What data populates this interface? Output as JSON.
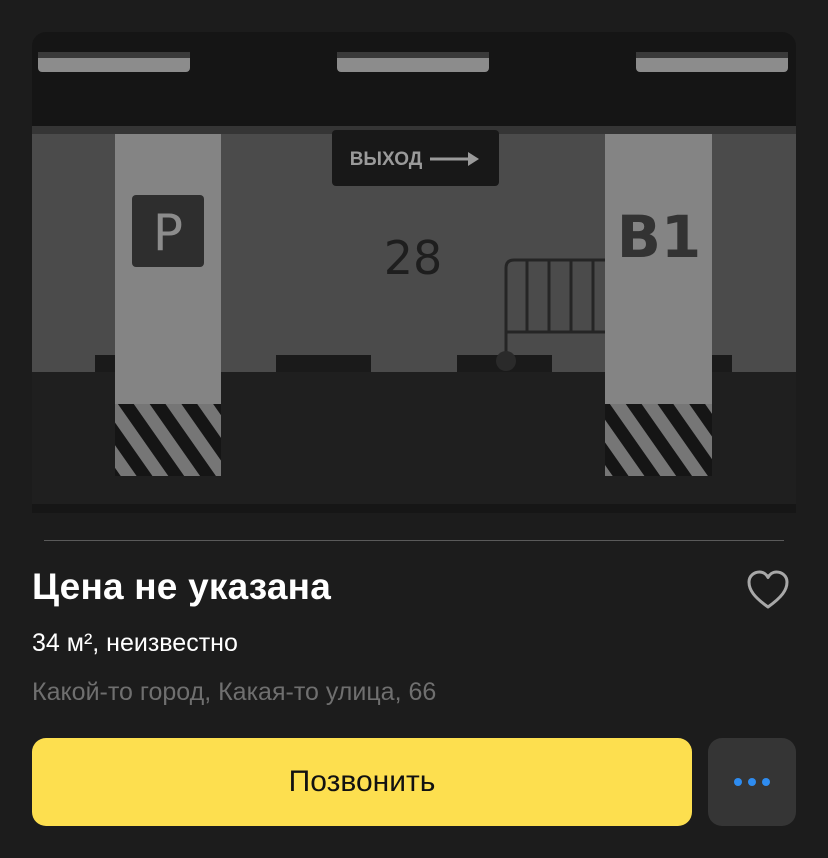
{
  "listing": {
    "photo": {
      "exit_sign": "ВЫХОД",
      "parking_sign": "P",
      "spot_number": "28",
      "level_label": "B1"
    },
    "price": "Цена не указана",
    "specs": "34 м², неизвестно",
    "address": "Какой-то город, Какая-то улица, 66",
    "call_label": "Позвонить",
    "favorite_icon": "heart-outline-icon",
    "more_icon": "more-dots-icon"
  },
  "colors": {
    "background": "#1c1c1c",
    "call_button": "#fddf4f",
    "more_button": "#353535",
    "more_dots": "#2e8cf0",
    "address_text": "#6f6f6f"
  }
}
